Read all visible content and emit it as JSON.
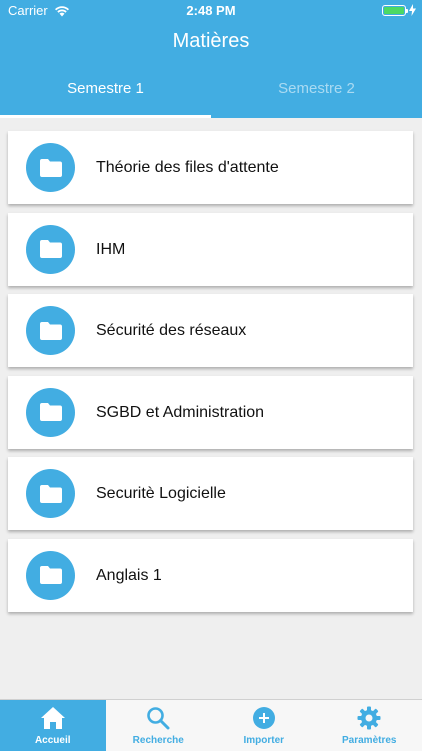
{
  "status_bar": {
    "carrier": "Carrier",
    "time": "2:48 PM",
    "battery_level": 1.0
  },
  "header": {
    "title": "Matières",
    "tabs": [
      {
        "label": "Semestre 1",
        "active": true
      },
      {
        "label": "Semestre 2",
        "active": false
      }
    ]
  },
  "subjects": [
    {
      "label": "Théorie des files d'attente",
      "icon": "folder-icon"
    },
    {
      "label": "IHM",
      "icon": "folder-icon"
    },
    {
      "label": "Sécurité des réseaux",
      "icon": "folder-icon"
    },
    {
      "label": "SGBD et Administration",
      "icon": "folder-icon"
    },
    {
      "label": "Securitè Logicielle",
      "icon": "folder-icon"
    },
    {
      "label": "Anglais 1",
      "icon": "folder-icon"
    }
  ],
  "tab_bar": {
    "items": [
      {
        "label": "Accueil",
        "icon": "home-icon",
        "active": true
      },
      {
        "label": "Recherche",
        "icon": "search-icon",
        "active": false
      },
      {
        "label": "Importer",
        "icon": "plus-circle-icon",
        "active": false
      },
      {
        "label": "Paramètres",
        "icon": "gear-icon",
        "active": false
      }
    ]
  },
  "colors": {
    "accent": "#42ade2",
    "background": "#efefef",
    "battery": "#4cd964"
  }
}
